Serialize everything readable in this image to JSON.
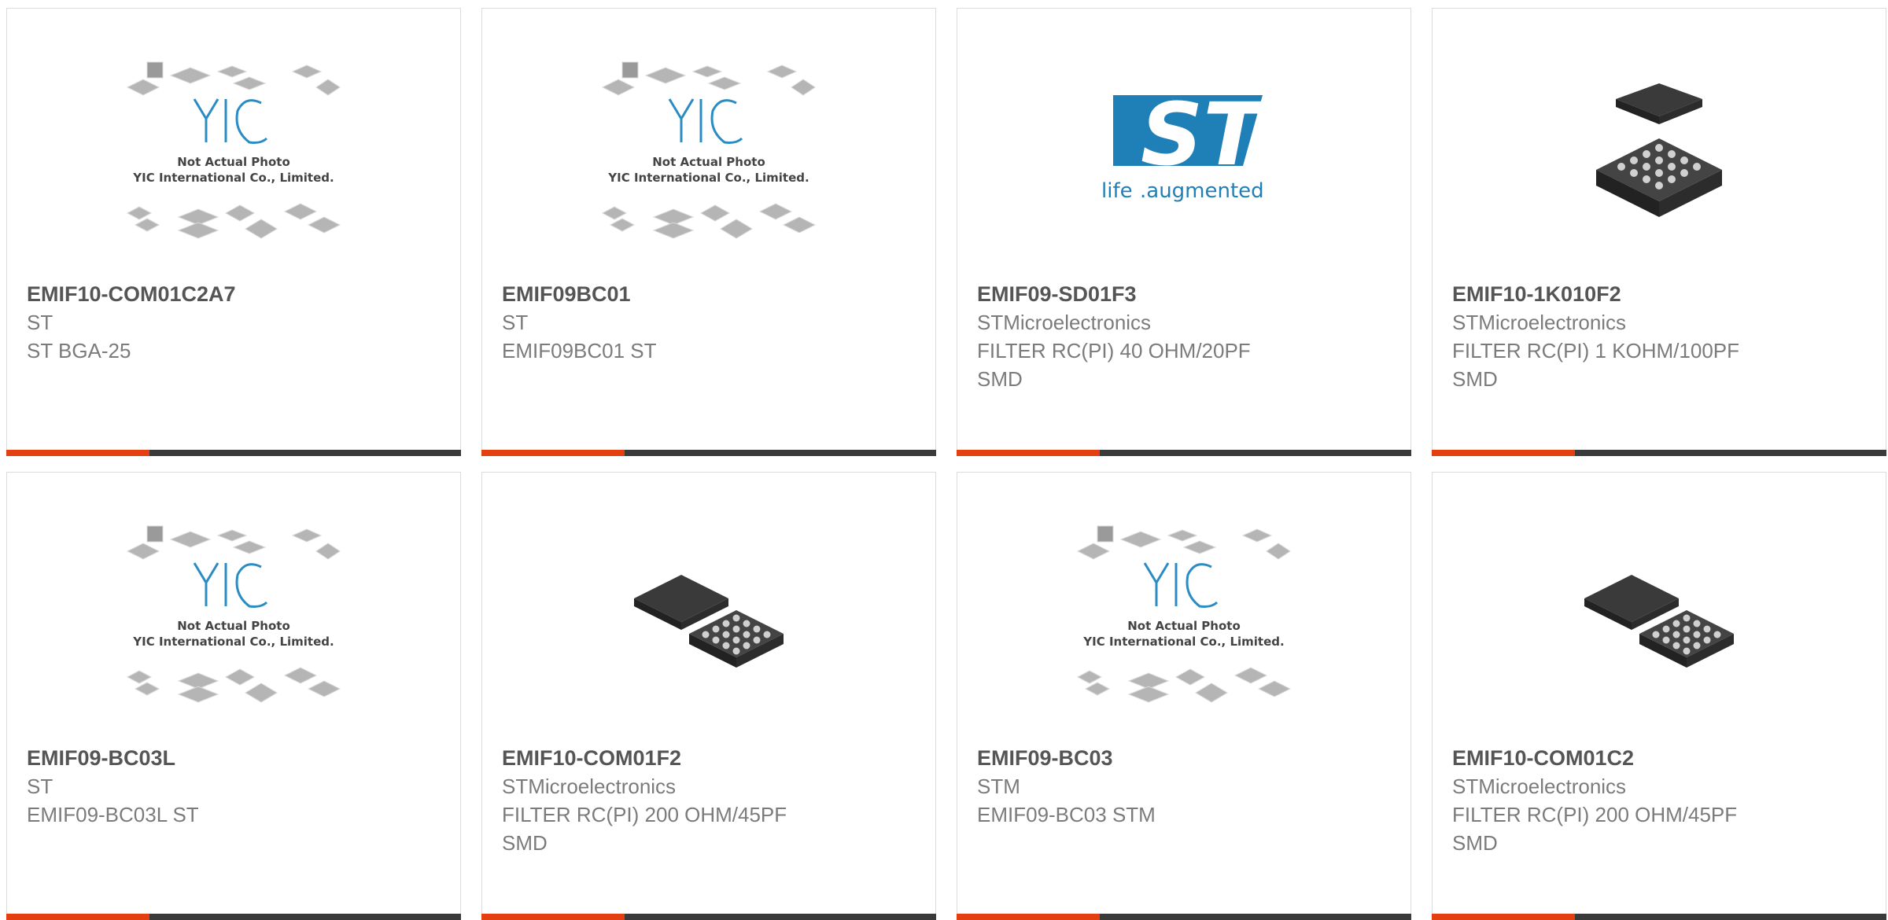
{
  "colors": {
    "accent": "#e43f10",
    "bar": "#3a3a3a",
    "st_blue": "#1f7fb7"
  },
  "placeholder_image": {
    "brand": "YIC",
    "line1": "Not Actual Photo",
    "line2": "YIC International Co., Limited."
  },
  "st_logo": {
    "tagline_a": "life",
    "tagline_b": ".augmented"
  },
  "products": [
    {
      "part": "EMIF10-COM01C2A7",
      "maker": "ST",
      "desc": [
        "ST BGA-25"
      ],
      "image": "yic-placeholder"
    },
    {
      "part": "EMIF09BC01",
      "maker": "ST",
      "desc": [
        "EMIF09BC01 ST"
      ],
      "image": "yic-placeholder"
    },
    {
      "part": "EMIF09-SD01F3",
      "maker": "STMicroelectronics",
      "desc": [
        "FILTER RC(PI) 40 OHM/20PF",
        "SMD"
      ],
      "image": "st-logo"
    },
    {
      "part": "EMIF10-1K010F2",
      "maker": "STMicroelectronics",
      "desc": [
        "FILTER RC(PI) 1 KOHM/100PF",
        "SMD"
      ],
      "image": "bga-chip-stacked"
    },
    {
      "part": "EMIF09-BC03L",
      "maker": "ST",
      "desc": [
        "EMIF09-BC03L ST"
      ],
      "image": "yic-placeholder"
    },
    {
      "part": "EMIF10-COM01F2",
      "maker": "STMicroelectronics",
      "desc": [
        "FILTER RC(PI) 200 OHM/45PF",
        "SMD"
      ],
      "image": "bga-chip-pair"
    },
    {
      "part": "EMIF09-BC03",
      "maker": "STM",
      "desc": [
        "EMIF09-BC03 STM"
      ],
      "image": "yic-placeholder"
    },
    {
      "part": "EMIF10-COM01C2",
      "maker": "STMicroelectronics",
      "desc": [
        "FILTER RC(PI) 200 OHM/45PF",
        "SMD"
      ],
      "image": "bga-chip-pair"
    }
  ]
}
